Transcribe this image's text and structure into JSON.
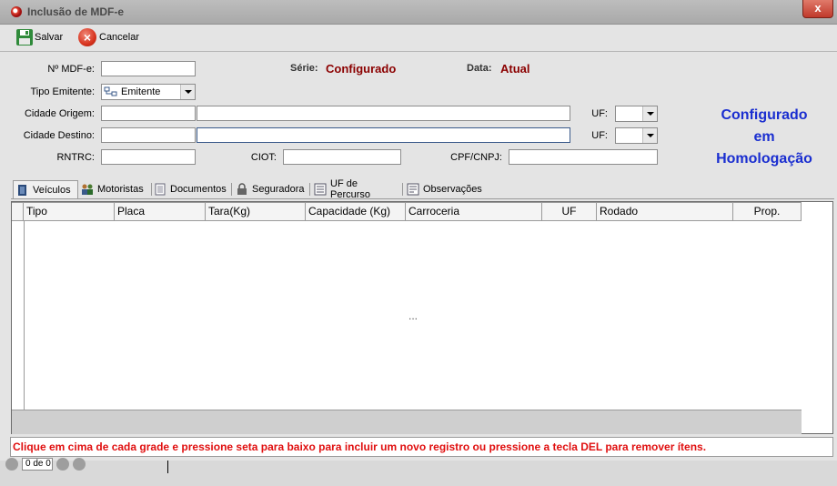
{
  "window": {
    "title": "Inclusão de MDF-e",
    "close_label": "x"
  },
  "toolbar": {
    "save_label": "Salvar",
    "cancel_label": "Cancelar"
  },
  "form": {
    "numero_label": "Nº MDF-e:",
    "serie_label": "Série:",
    "serie_value": "Configurado",
    "data_label": "Data:",
    "data_value": "Atual",
    "tipo_emitente_label": "Tipo Emitente:",
    "tipo_emitente_value": "Emitente",
    "cidade_origem_label": "Cidade Origem:",
    "cidade_destino_label": "Cidade Destino:",
    "uf_label": "UF:",
    "rntrc_label": "RNTRC:",
    "ciot_label": "CIOT:",
    "cpf_label": "CPF/CNPJ:"
  },
  "env_message": {
    "line1": "Configurado",
    "line2": "em",
    "line3": "Homologação",
    "color": "#1a2ed0"
  },
  "tabs": [
    {
      "label": "Veículos",
      "icon": "door-icon"
    },
    {
      "label": "Motoristas",
      "icon": "people-icon"
    },
    {
      "label": "Documentos",
      "icon": "document-icon"
    },
    {
      "label": "Seguradora",
      "icon": "lock-icon"
    },
    {
      "label": "UF de Percurso",
      "icon": "list-icon"
    },
    {
      "label": "Observações",
      "icon": "notes-icon"
    }
  ],
  "grid": {
    "columns": [
      "Tipo",
      "Placa",
      "Tara(Kg)",
      "Capacidade (Kg)",
      "Carroceria",
      "UF",
      "Rodado",
      "Prop."
    ],
    "empty_marker": "..."
  },
  "status_message": "Clique em cima de cada grade e pressione seta para baixo para incluir um novo registro ou pressione a tecla DEL para remover ítens.",
  "pager": {
    "text": "0 de 0"
  }
}
